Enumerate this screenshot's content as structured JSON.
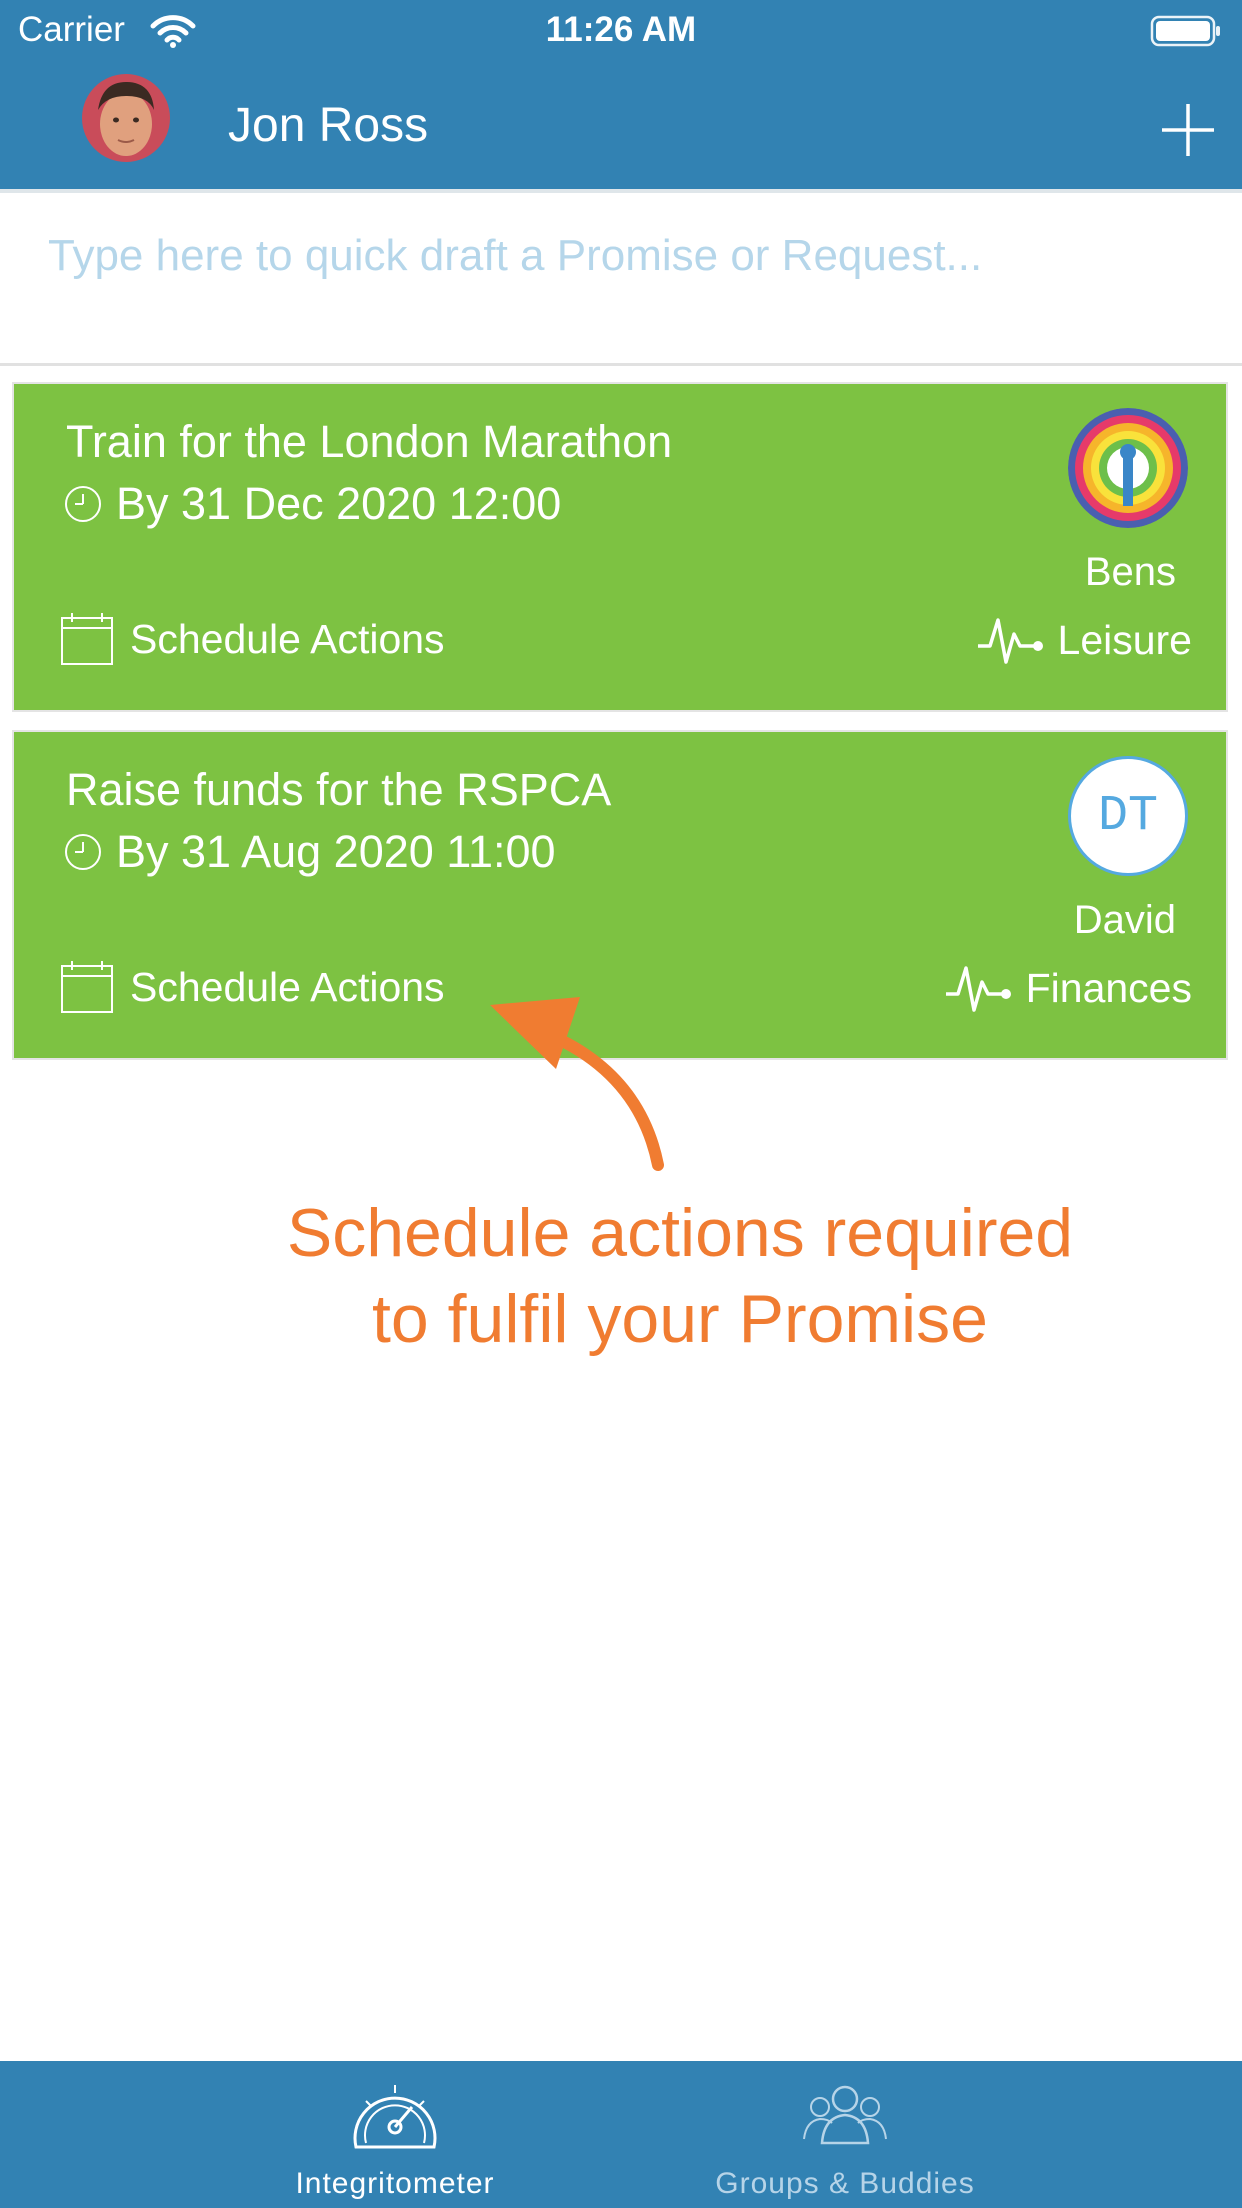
{
  "status_bar": {
    "carrier": "Carrier",
    "time": "11:26 AM"
  },
  "header": {
    "user_name": "Jon Ross",
    "avatar_icon": "user-avatar-photo",
    "add_icon": "plus-icon"
  },
  "quick_draft": {
    "placeholder": "Type here to quick draft a Promise or Request...",
    "value": ""
  },
  "promises": [
    {
      "title": "Train for the London Marathon",
      "due": "By 31 Dec 2020 12:00",
      "action_label": "Schedule Actions",
      "category": "Leisure",
      "buddy_name": "Bens",
      "buddy_avatar": "rainbow-target-avatar"
    },
    {
      "title": "Raise funds for the RSPCA",
      "due": "By 31 Aug 2020 11:00",
      "action_label": "Schedule Actions",
      "category": "Finances",
      "buddy_name": "David",
      "buddy_initials": "DT"
    }
  ],
  "annotation": {
    "line1": "Schedule actions required",
    "line2": "to fulfil your Promise"
  },
  "tabs": [
    {
      "label": "Integritometer",
      "icon": "speedometer-icon",
      "active": true
    },
    {
      "label": "Groups & Buddies",
      "icon": "group-icon",
      "active": false
    }
  ],
  "colors": {
    "brand_blue": "#3282b3",
    "card_green": "#7dc242",
    "annotation_orange": "#f07c31",
    "initials_blue": "#55a9e0"
  }
}
